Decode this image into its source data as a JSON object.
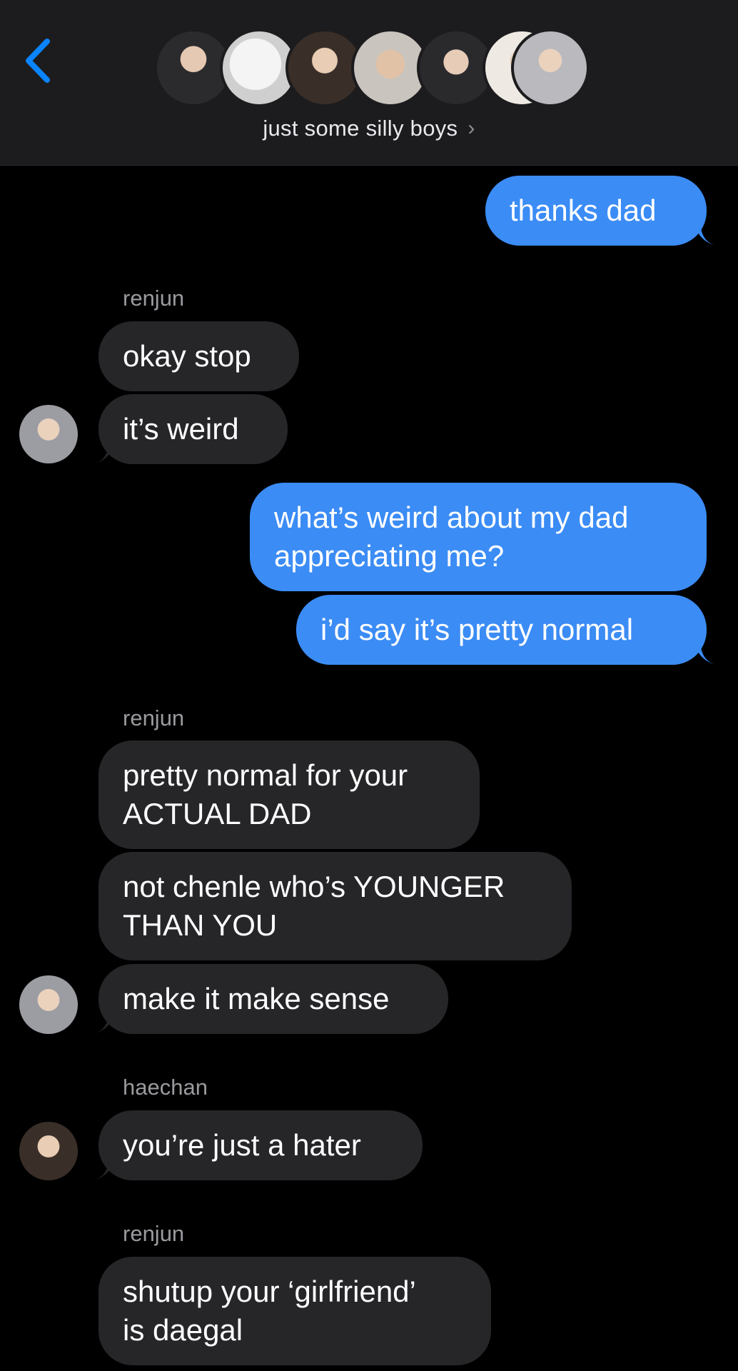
{
  "header": {
    "group_name": "just some silly boys",
    "chevron": "›",
    "back_icon": "chevron-left-icon",
    "avatar_count": 7
  },
  "colors": {
    "outgoing_bubble": "#3b8cf5",
    "incoming_bubble": "#262629",
    "accent": "#0a84ff",
    "background": "#000000"
  },
  "messages": [
    {
      "direction": "outgoing",
      "text": "thanks dad"
    },
    {
      "sender": "renjun"
    },
    {
      "direction": "incoming",
      "text": "okay stop"
    },
    {
      "direction": "incoming",
      "text": "it’s weird"
    },
    {
      "direction": "outgoing",
      "text": "what’s weird about my dad\nappreciating me?"
    },
    {
      "direction": "outgoing",
      "text": "i’d say it’s pretty normal"
    },
    {
      "sender": "renjun"
    },
    {
      "direction": "incoming",
      "text": "pretty normal for your\nACTUAL DAD"
    },
    {
      "direction": "incoming",
      "text": "not chenle who’s YOUNGER\nTHAN YOU"
    },
    {
      "direction": "incoming",
      "text": "make it make sense"
    },
    {
      "sender": "haechan"
    },
    {
      "direction": "incoming",
      "text": "you’re just a hater"
    },
    {
      "sender": "renjun"
    },
    {
      "direction": "incoming",
      "text": "shutup your ‘girlfriend’\nis daegal"
    }
  ]
}
